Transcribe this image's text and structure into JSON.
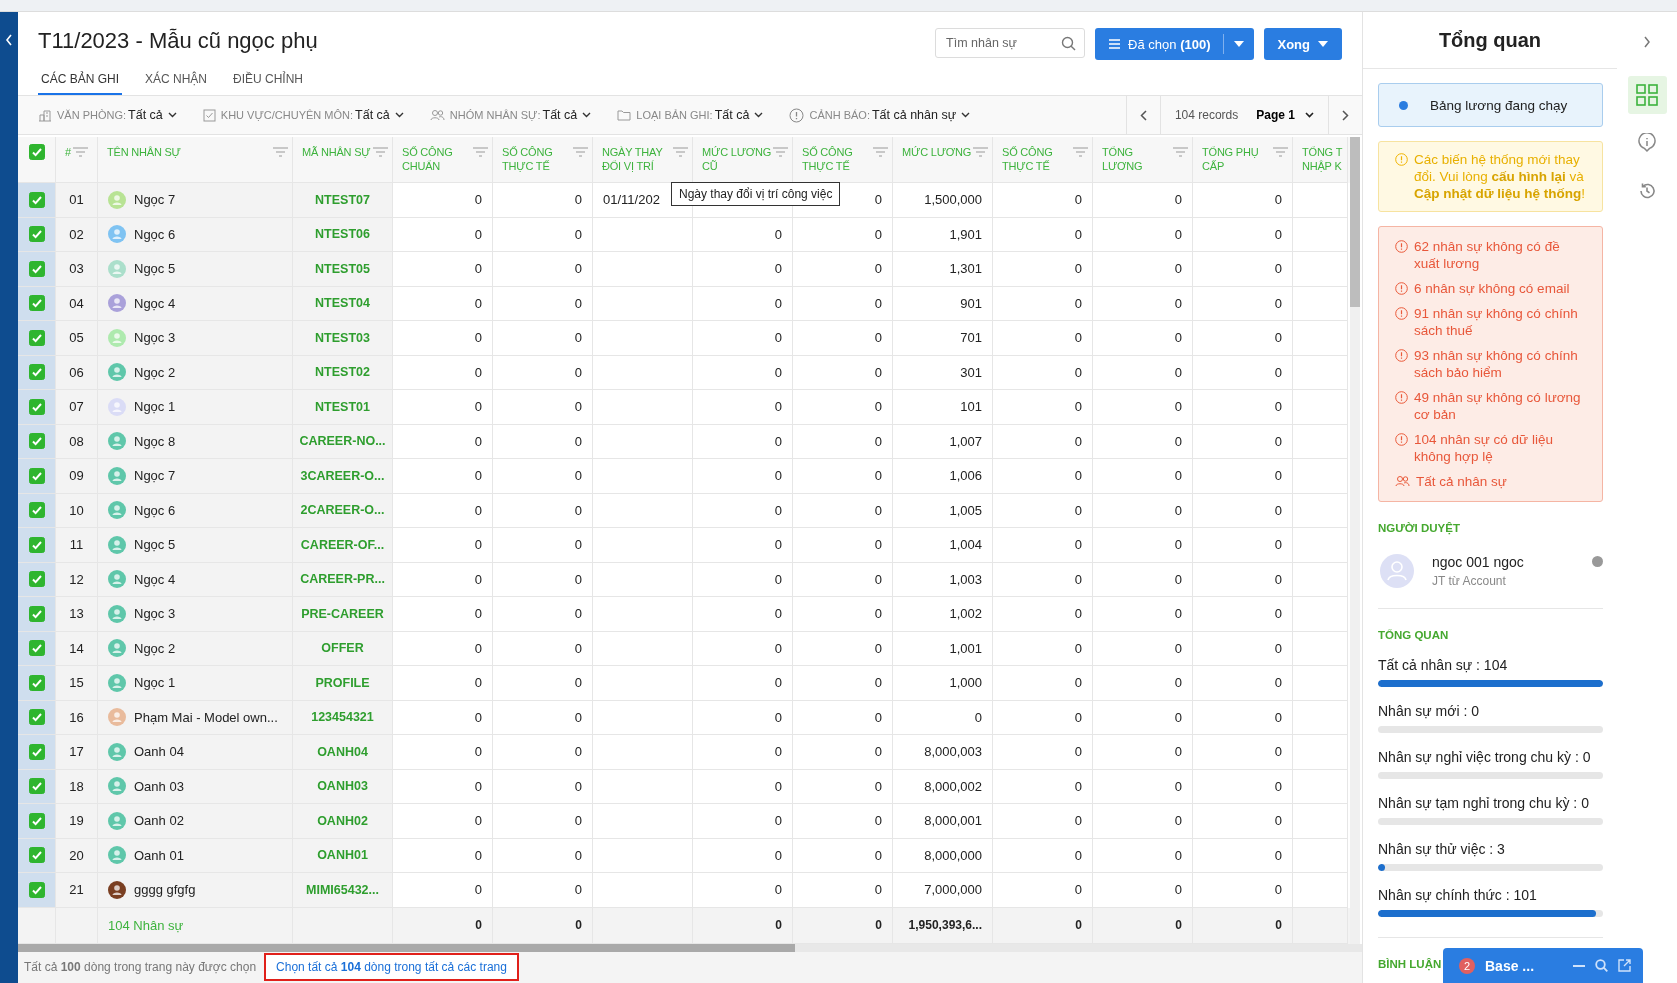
{
  "title": "T11/2023 - Mẫu cũ ngọc phụ",
  "tabs": [
    {
      "label": "CÁC BẢN GHI",
      "selected": true
    },
    {
      "label": "XÁC NHẬN",
      "selected": false
    },
    {
      "label": "ĐIỀU CHỈNH",
      "selected": false
    }
  ],
  "search": {
    "placeholder": "Tìm nhân sự"
  },
  "selected_button": {
    "label": "Đã chọn **(100)**"
  },
  "done_button": {
    "label": "Xong"
  },
  "filters": [
    {
      "kind": "office",
      "label": "VĂN PHÒNG:",
      "value": "Tất cả"
    },
    {
      "kind": "check",
      "label": "KHU VỰC/CHUYÊN MÔN:",
      "value": "Tất cả"
    },
    {
      "kind": "people",
      "label": "NHÓM NHÂN SỰ:",
      "value": "Tất cả"
    },
    {
      "kind": "folder",
      "label": "LOẠI BẢN GHI:",
      "value": "Tất cả"
    },
    {
      "kind": "alert",
      "label": "CẢNH BÁO:",
      "value": "Tất cả nhân sự"
    }
  ],
  "pagination": {
    "records": "104 records",
    "page": "Page 1"
  },
  "table": {
    "all_selected": true,
    "columns": [
      {
        "label": "#",
        "kind": "index"
      },
      {
        "label": "TÊN NHÂN SỰ",
        "kind": "name"
      },
      {
        "label": "MÃ NHÂN SỰ",
        "kind": "code"
      },
      {
        "label": "SỐ CÔNG CHUẨN",
        "kind": "number"
      },
      {
        "label": "SỐ CÔNG THỰC TẾ",
        "kind": "number"
      },
      {
        "label": "NGÀY THAY ĐỔI VỊ TRÍ",
        "kind": "date"
      },
      {
        "label": "MỨC LƯƠNG CŨ",
        "kind": "number"
      },
      {
        "label": "SỐ CÔNG THỰC TẾ",
        "kind": "number"
      },
      {
        "label": "MỨC LƯƠNG",
        "kind": "number"
      },
      {
        "label": "SỐ CÔNG THỰC TẾ",
        "kind": "number"
      },
      {
        "label": "TỔNG LƯƠNG",
        "kind": "number"
      },
      {
        "label": "TỔNG PHỤ CẤP",
        "kind": "number"
      },
      {
        "label": "TỔNG T NHẬP K",
        "kind": "cut"
      }
    ],
    "rows": [
      {
        "color": "#b8e394",
        "selected": true,
        "cells": [
          "01",
          "Ngọc 7",
          "NTEST07",
          "0",
          "0",
          "01/11/202",
          "",
          "0",
          "1,500,000",
          "0",
          "0",
          "0"
        ]
      },
      {
        "color": "#7fc3f2",
        "selected": true,
        "cells": [
          "02",
          "Ngọc 6",
          "NTEST06",
          "0",
          "0",
          "",
          "0",
          "0",
          "1,901",
          "0",
          "0",
          "0"
        ]
      },
      {
        "color": "#abdfcb",
        "selected": true,
        "cells": [
          "03",
          "Ngọc 5",
          "NTEST05",
          "0",
          "0",
          "",
          "0",
          "0",
          "1,301",
          "0",
          "0",
          "0"
        ]
      },
      {
        "color": "#aaa1da",
        "selected": true,
        "cells": [
          "04",
          "Ngọc 4",
          "NTEST04",
          "0",
          "0",
          "",
          "0",
          "0",
          "901",
          "0",
          "0",
          "0"
        ]
      },
      {
        "color": "#aeeaae",
        "selected": true,
        "cells": [
          "05",
          "Ngọc 3",
          "NTEST03",
          "0",
          "0",
          "",
          "0",
          "0",
          "701",
          "0",
          "0",
          "0"
        ]
      },
      {
        "color": "#5fc7aa",
        "selected": true,
        "cells": [
          "06",
          "Ngọc 2",
          "NTEST02",
          "0",
          "0",
          "",
          "0",
          "0",
          "301",
          "0",
          "0",
          "0"
        ]
      },
      {
        "color": "#dadcf6",
        "selected": true,
        "cells": [
          "07",
          "Ngọc 1",
          "NTEST01",
          "0",
          "0",
          "",
          "0",
          "0",
          "101",
          "0",
          "0",
          "0"
        ]
      },
      {
        "color": "#5fc7aa",
        "selected": true,
        "cells": [
          "08",
          "Ngọc 8",
          "CAREER-NO...",
          "0",
          "0",
          "",
          "0",
          "0",
          "1,007",
          "0",
          "0",
          "0"
        ]
      },
      {
        "color": "#5fc7aa",
        "selected": true,
        "cells": [
          "09",
          "Ngọc 7",
          "3CAREER-O...",
          "0",
          "0",
          "",
          "0",
          "0",
          "1,006",
          "0",
          "0",
          "0"
        ]
      },
      {
        "color": "#5fc7aa",
        "selected": true,
        "cells": [
          "10",
          "Ngọc 6",
          "2CAREER-O...",
          "0",
          "0",
          "",
          "0",
          "0",
          "1,005",
          "0",
          "0",
          "0"
        ]
      },
      {
        "color": "#5fc7aa",
        "selected": true,
        "cells": [
          "11",
          "Ngọc 5",
          "CAREER-OF...",
          "0",
          "0",
          "",
          "0",
          "0",
          "1,004",
          "0",
          "0",
          "0"
        ]
      },
      {
        "color": "#5fc7aa",
        "selected": true,
        "cells": [
          "12",
          "Ngọc 4",
          "CAREER-PR...",
          "0",
          "0",
          "",
          "0",
          "0",
          "1,003",
          "0",
          "0",
          "0"
        ]
      },
      {
        "color": "#5fc7aa",
        "selected": true,
        "cells": [
          "13",
          "Ngọc 3",
          "PRE-CAREER",
          "0",
          "0",
          "",
          "0",
          "0",
          "1,002",
          "0",
          "0",
          "0"
        ]
      },
      {
        "color": "#5fc7aa",
        "selected": true,
        "cells": [
          "14",
          "Ngọc 2",
          "OFFER",
          "0",
          "0",
          "",
          "0",
          "0",
          "1,001",
          "0",
          "0",
          "0"
        ]
      },
      {
        "color": "#5fc7aa",
        "selected": true,
        "cells": [
          "15",
          "Ngọc 1",
          "PROFILE",
          "0",
          "0",
          "",
          "0",
          "0",
          "1,000",
          "0",
          "0",
          "0"
        ]
      },
      {
        "color": "#e9bb9c",
        "selected": true,
        "cells": [
          "16",
          "Phạm Mai - Model own...",
          "123454321",
          "0",
          "0",
          "",
          "0",
          "0",
          "0",
          "0",
          "0",
          "0"
        ]
      },
      {
        "color": "#5fc7aa",
        "selected": true,
        "cells": [
          "17",
          "Oanh 04",
          "OANH04",
          "0",
          "0",
          "",
          "0",
          "0",
          "8,000,003",
          "0",
          "0",
          "0"
        ]
      },
      {
        "color": "#5fc7aa",
        "selected": true,
        "cells": [
          "18",
          "Oanh 03",
          "OANH03",
          "0",
          "0",
          "",
          "0",
          "0",
          "8,000,002",
          "0",
          "0",
          "0"
        ]
      },
      {
        "color": "#5fc7aa",
        "selected": true,
        "cells": [
          "19",
          "Oanh 02",
          "OANH02",
          "0",
          "0",
          "",
          "0",
          "0",
          "8,000,001",
          "0",
          "0",
          "0"
        ]
      },
      {
        "color": "#5fc7aa",
        "selected": true,
        "cells": [
          "20",
          "Oanh 01",
          "OANH01",
          "0",
          "0",
          "",
          "0",
          "0",
          "8,000,000",
          "0",
          "0",
          "0"
        ]
      },
      {
        "color": "#7a3f22",
        "selected": true,
        "cells": [
          "21",
          "gggg gfgfg",
          "MIMI65432...",
          "0",
          "0",
          "",
          "0",
          "0",
          "7,000,000",
          "0",
          "0",
          "0"
        ]
      }
    ],
    "tooltip": "Ngày thay đổi vị trí công việc",
    "footer": {
      "cells": [
        "",
        "104 Nhân sự",
        "",
        "0",
        "0",
        "",
        "0",
        "0",
        "1,950,393,6...",
        "0",
        "0",
        "0"
      ]
    }
  },
  "selection_bar": {
    "text": "Tất cả **100** dòng trong trang này được chọn",
    "link": "Chọn tất cả **104** dòng trong tất cả các trang"
  },
  "panel": {
    "title": "Tổng quan",
    "status": {
      "label": "Bảng lương đang chạy"
    },
    "warning": "Các biến hệ thống mới thay đổi. Vui lòng **cấu hình lại** và **Cập nhật dữ liệu hệ thống**!",
    "errors": [
      {
        "kind": "alert",
        "text": "62 nhân sự không có đề xuất lương"
      },
      {
        "kind": "alert",
        "text": "6 nhân sự không có email"
      },
      {
        "kind": "alert",
        "text": "91 nhân sự không có chính sách thuế"
      },
      {
        "kind": "alert",
        "text": "93 nhân sự không có chính sách bảo hiểm"
      },
      {
        "kind": "alert",
        "text": "49 nhân sự không có lương cơ bản"
      },
      {
        "kind": "alert",
        "text": "104 nhân sự có dữ liệu không hợp lệ"
      },
      {
        "kind": "people",
        "text": "Tất cả nhân sự"
      }
    ],
    "approver_heading": "NGƯỜI DUYỆT",
    "approver": {
      "name": "ngoc 001 ngoc",
      "subtitle": "JT từ Account",
      "online": false
    },
    "stats_heading": "TỔNG QUAN",
    "stats": [
      {
        "label": "Tất cả nhân sự : 104",
        "level": 1
      },
      {
        "label": "Nhân sự mới : 0",
        "level": 0
      },
      {
        "label": "Nhân sự nghỉ việc trong chu kỳ : 0",
        "level": 0
      },
      {
        "label": "Nhân sự tạm nghỉ trong chu kỳ : 0",
        "level": 0
      },
      {
        "label": "Nhân sự thử việc : 3",
        "level": 0.03
      },
      {
        "label": "Nhân sự chính thức : 101",
        "level": 0.97
      }
    ],
    "comments_heading": "BÌNH LUẬN"
  },
  "rail": [
    {
      "kind": "grid",
      "selected": true
    },
    {
      "kind": "info",
      "selected": false
    },
    {
      "kind": "history",
      "selected": false
    }
  ],
  "chat": {
    "badge": "2",
    "title": "Base ..."
  }
}
